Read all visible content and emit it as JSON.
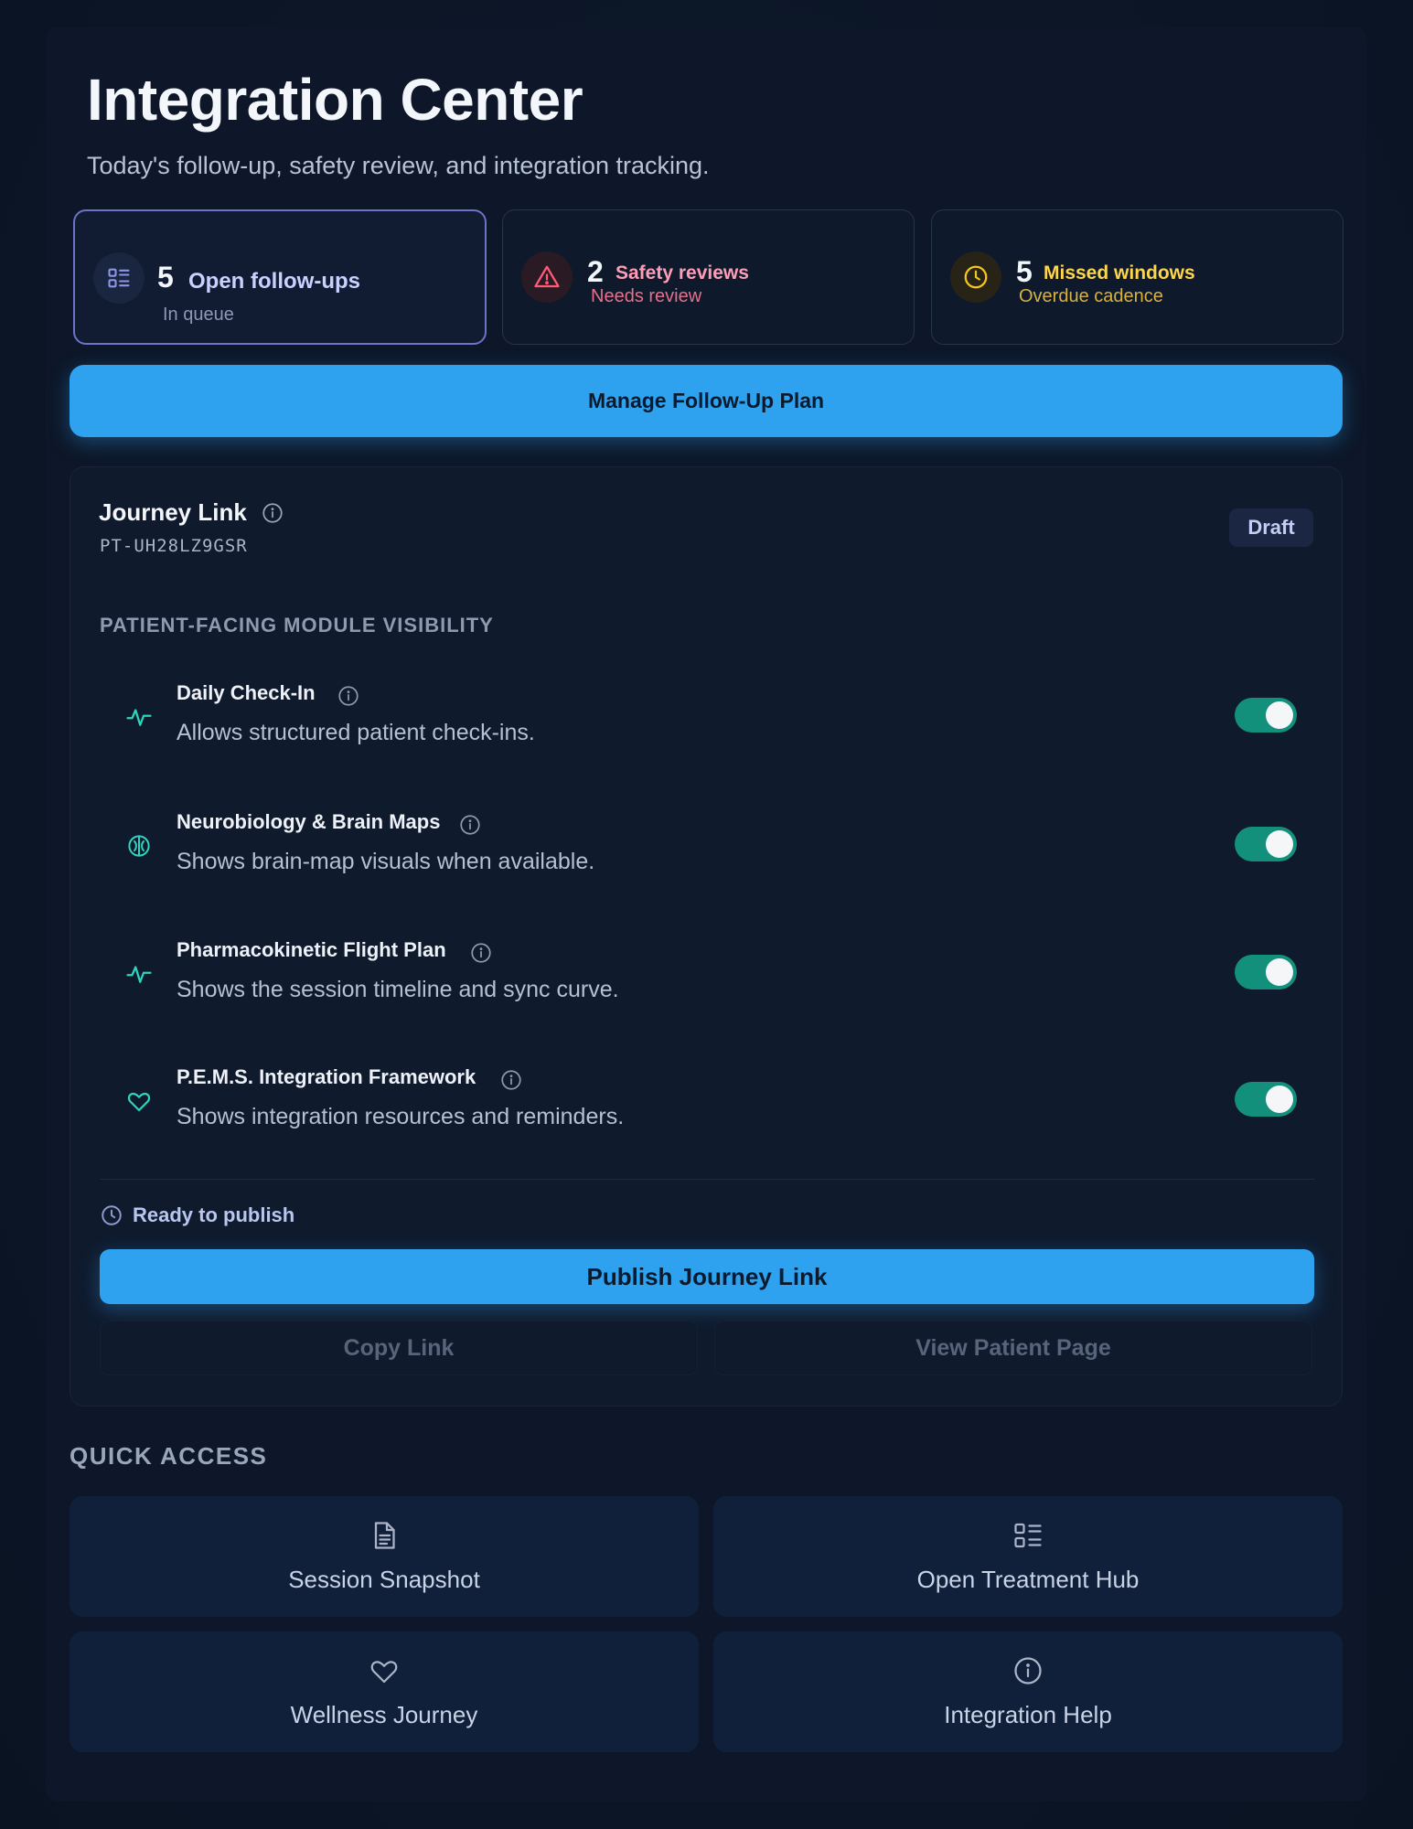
{
  "header": {
    "title": "Integration Center",
    "subtitle": "Today's follow-up, safety review, and integration tracking."
  },
  "stats": [
    {
      "count": "5",
      "label": "Open follow-ups",
      "sub": "In queue",
      "icon": "list-icon",
      "color": "#c9d2ff"
    },
    {
      "count": "2",
      "label": "Safety reviews",
      "sub": "Needs review",
      "icon": "warning-icon",
      "color": "#ff9db6"
    },
    {
      "count": "5",
      "label": "Missed windows",
      "sub": "Overdue cadence",
      "icon": "clock-icon",
      "color": "#ffd54a"
    }
  ],
  "manage_button": "Manage Follow-Up Plan",
  "journey": {
    "title": "Journey Link",
    "code": "PT-UH28LZ9GSR",
    "status": "Draft",
    "section_label": "PATIENT-FACING MODULE VISIBILITY",
    "modules": [
      {
        "name": "Daily Check-In",
        "desc": "Allows structured patient check-ins.",
        "icon": "pulse-icon",
        "enabled": true
      },
      {
        "name": "Neurobiology & Brain Maps",
        "desc": "Shows brain-map visuals when available.",
        "icon": "brain-icon",
        "enabled": true
      },
      {
        "name": "Pharmacokinetic Flight Plan",
        "desc": "Shows the session timeline and sync curve.",
        "icon": "pulse-icon",
        "enabled": true
      },
      {
        "name": "P.E.M.S. Integration Framework",
        "desc": "Shows integration resources and reminders.",
        "icon": "heart-icon",
        "enabled": true
      }
    ],
    "ready_text": "Ready to publish",
    "publish_button": "Publish Journey Link",
    "copy_button": "Copy Link",
    "view_button": "View Patient Page"
  },
  "quick_access": {
    "label": "QUICK ACCESS",
    "tiles": [
      {
        "label": "Session Snapshot",
        "icon": "document-icon"
      },
      {
        "label": "Open Treatment Hub",
        "icon": "grid-list-icon"
      },
      {
        "label": "Wellness Journey",
        "icon": "heart-icon"
      },
      {
        "label": "Integration Help",
        "icon": "info-icon"
      }
    ]
  },
  "colors": {
    "accent": "#2ea1ef",
    "toggle_on": "#12907c",
    "teal_icon": "#2dd4bf"
  }
}
